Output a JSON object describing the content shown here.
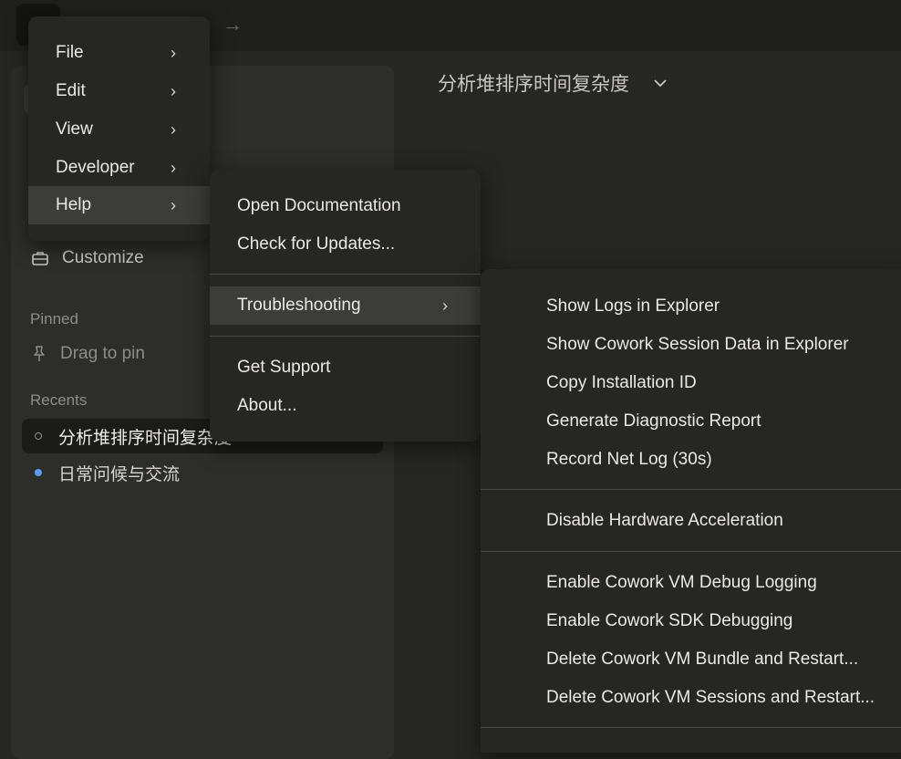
{
  "topbar": {
    "forward_arrow": "→"
  },
  "sidebar": {
    "customize_label": "Customize",
    "pinned_heading": "Pinned",
    "pin_hint": "Drag to pin",
    "recents_heading": "Recents",
    "recents": [
      {
        "label": "分析堆排序时间复杂度",
        "active": true
      },
      {
        "label": "日常问候与交流",
        "active": false
      }
    ]
  },
  "main": {
    "conversation_title": "分析堆排序时间复杂度"
  },
  "menus": {
    "main": [
      "File",
      "Edit",
      "View",
      "Developer",
      "Help"
    ],
    "help": {
      "group1": [
        "Open Documentation",
        "Check for Updates..."
      ],
      "troubleshooting": "Troubleshooting",
      "group3": [
        "Get Support",
        "About..."
      ]
    },
    "troubleshooting": {
      "group1": [
        "Show Logs in Explorer",
        "Show Cowork Session Data in Explorer",
        "Copy Installation ID",
        "Generate Diagnostic Report",
        "Record Net Log (30s)"
      ],
      "group2": [
        "Disable Hardware Acceleration"
      ],
      "group3": [
        "Enable Cowork VM Debug Logging",
        "Enable Cowork SDK Debugging",
        "Delete Cowork VM Bundle and Restart...",
        "Delete Cowork VM Sessions and Restart..."
      ]
    }
  },
  "colors": {
    "accent_dot": "#5b9cf0",
    "menu_bg": "#262625",
    "highlight": "#3c3c3a"
  }
}
